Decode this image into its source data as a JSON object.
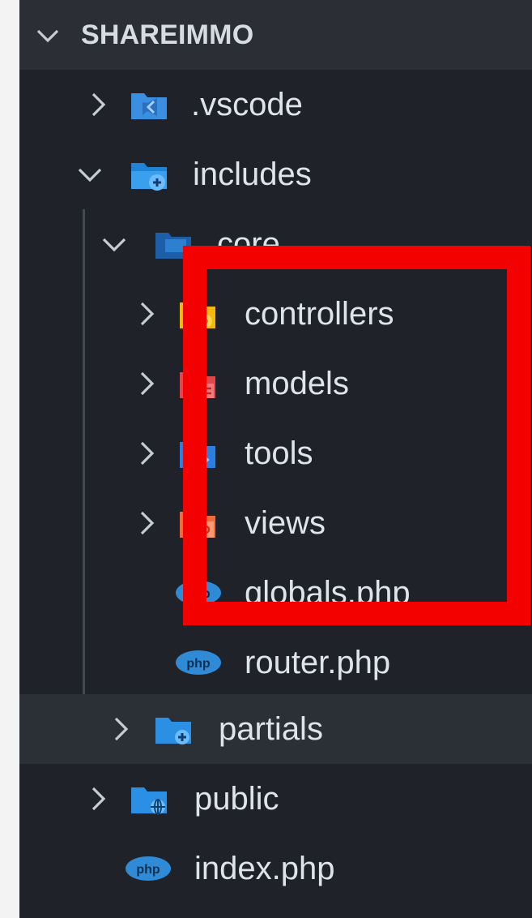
{
  "explorer": {
    "section_title": "SHAREIMMO",
    "items": [
      {
        "label": ".vscode",
        "type": "folder",
        "expanded": false,
        "icon": "vscode-folder-icon"
      },
      {
        "label": "includes",
        "type": "folder",
        "expanded": true,
        "icon": "includes-folder-icon"
      },
      {
        "label": "core",
        "type": "folder",
        "expanded": true,
        "icon": "core-folder-icon"
      },
      {
        "label": "controllers",
        "type": "folder",
        "expanded": false,
        "icon": "controllers-folder-icon"
      },
      {
        "label": "models",
        "type": "folder",
        "expanded": false,
        "icon": "models-folder-icon"
      },
      {
        "label": "tools",
        "type": "folder",
        "expanded": false,
        "icon": "tools-folder-icon"
      },
      {
        "label": "views",
        "type": "folder",
        "expanded": false,
        "icon": "views-folder-icon"
      },
      {
        "label": "globals.php",
        "type": "file",
        "icon": "php-file-icon"
      },
      {
        "label": "router.php",
        "type": "file",
        "icon": "php-file-icon"
      },
      {
        "label": "partials",
        "type": "folder",
        "expanded": false,
        "icon": "partials-folder-icon"
      },
      {
        "label": "public",
        "type": "folder",
        "expanded": false,
        "icon": "public-folder-icon"
      },
      {
        "label": "index.php",
        "type": "file",
        "icon": "php-file-icon"
      }
    ],
    "php_badge_text": "php",
    "colors": {
      "background": "#1f2228",
      "header": "#2b2e35",
      "highlight": "#f30000",
      "text": "#dfe3ea"
    }
  }
}
